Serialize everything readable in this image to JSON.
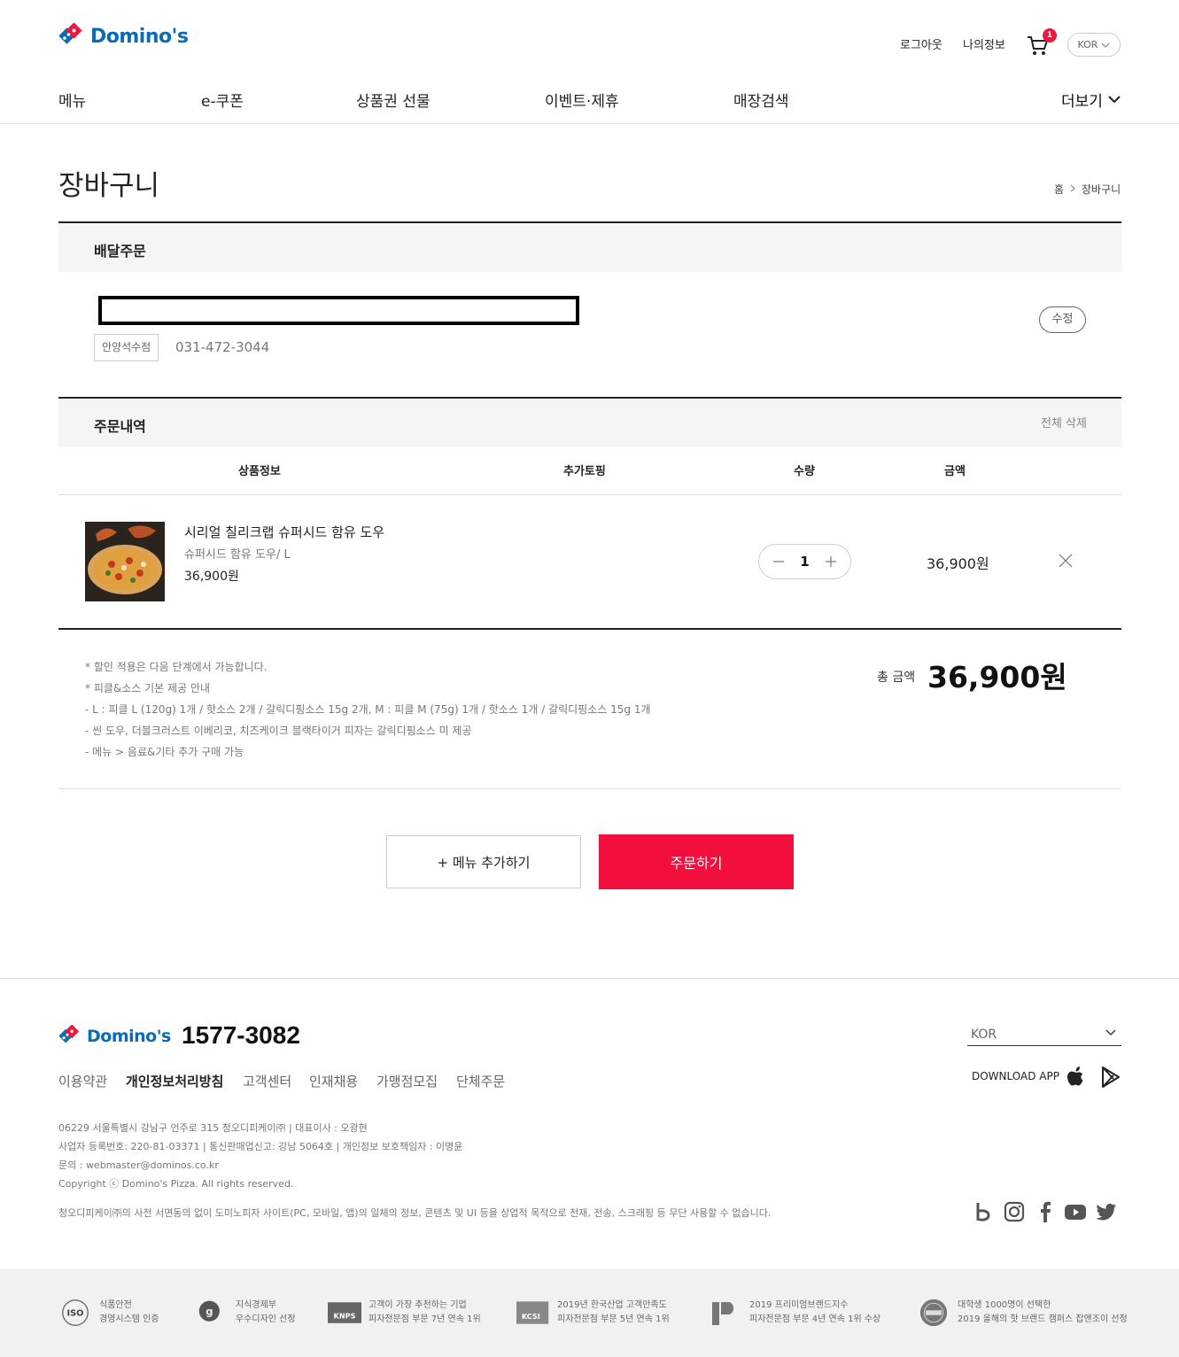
{
  "header": {
    "logo": "Domino's",
    "logout": "로그아웃",
    "my_info": "나의정보",
    "cart_count": "1",
    "lang": "KOR"
  },
  "nav": {
    "items": [
      "메뉴",
      "e-쿠폰",
      "상품권 선물",
      "이벤트·제휴",
      "매장검색"
    ],
    "more": "더보기"
  },
  "page": {
    "title": "장바구니",
    "breadcrumb": {
      "home": "홈",
      "current": "장바구니"
    }
  },
  "delivery": {
    "section_title": "배달주문",
    "store": "안양석수점",
    "phone": "031-472-3044",
    "edit": "수정"
  },
  "order": {
    "section_title": "주문내역",
    "delete_all": "전체 삭제",
    "columns": [
      "상품정보",
      "추가토핑",
      "수량",
      "금액"
    ],
    "items": [
      {
        "name": "시리얼 칠리크랩 슈퍼시드 함유 도우",
        "option": "슈퍼시드 함유 도우/ L",
        "price": "36,900원",
        "quantity": "1",
        "amount": "36,900원"
      }
    ],
    "notes": [
      "* 할인 적용은 다음 단계에서 가능합니다.",
      "* 피클&소스 기본 제공 안내",
      "- L : 피클 L (120g) 1개 / 핫소스 2개 / 갈릭디핑소스 15g 2개, M : 피클 M (75g) 1개 / 핫소스 1개 / 갈릭디핑소스 15g 1개",
      "- 씬 도우, 더블크러스트 이베리코, 치즈케이크 블랙타이거 피자는 갈릭디핑소스 미 제공",
      "- 메뉴 > 음료&기타 추가 구매 가능"
    ],
    "total_label": "총 금액",
    "total_value": "36,900원"
  },
  "buttons": {
    "add_menu": "+ 메뉴 추가하기",
    "order": "주문하기"
  },
  "footer": {
    "tel": "1577-3082",
    "links": [
      "이용약관",
      "개인정보처리방침",
      "고객센터",
      "인재채용",
      "가맹점모집",
      "단체주문"
    ],
    "lang": "KOR",
    "download_app": "DOWNLOAD APP",
    "info": [
      "06229 서울특별시 강남구 언주로 315 청오디피케이㈜ | 대표이사 : 오광현",
      "사업자 등록번호: 220-81-03371 | 통신판매업신고: 강남 5064호 | 개인정보 보호책임자 : 이명윤",
      "문의 : webmaster@dominos.co.kr",
      "Copyright ⓒ Domino's Pizza. All rights reserved.",
      "청오디피케이㈜의 사전 서면동의 없이 도미노피자 사이트(PC, 모바일, 앱)의 일체의 정보, 콘텐츠 및 UI 등을 상업적 목적으로 전재, 전송, 스크래핑 등 무단 사용할 수 없습니다."
    ],
    "awards": [
      {
        "line1": "식품안전",
        "line2": "경영시스템 인증"
      },
      {
        "line1": "지식경제부",
        "line2": "우수디자인 선정"
      },
      {
        "line1": "고객이 가장 추천하는 기업",
        "line2": "피자전문점 부문 7년 연속 1위"
      },
      {
        "line1": "2019년 한국산업 고객만족도",
        "line2": "피자전문점 부문 5년 연속 1위"
      },
      {
        "line1": "2019 프리미엄브랜드지수",
        "line2": "피자전문점 부문 4년 연속 1위 수상"
      },
      {
        "line1": "대학생 1000명이 선택한",
        "line2": "2019 올해의 핫 브랜드 캠퍼스 잡앤조이 선정"
      }
    ]
  },
  "colors": {
    "brand_blue": "#0b6bb5",
    "brand_red": "#e8193d",
    "order_button": "#f20f3d"
  }
}
